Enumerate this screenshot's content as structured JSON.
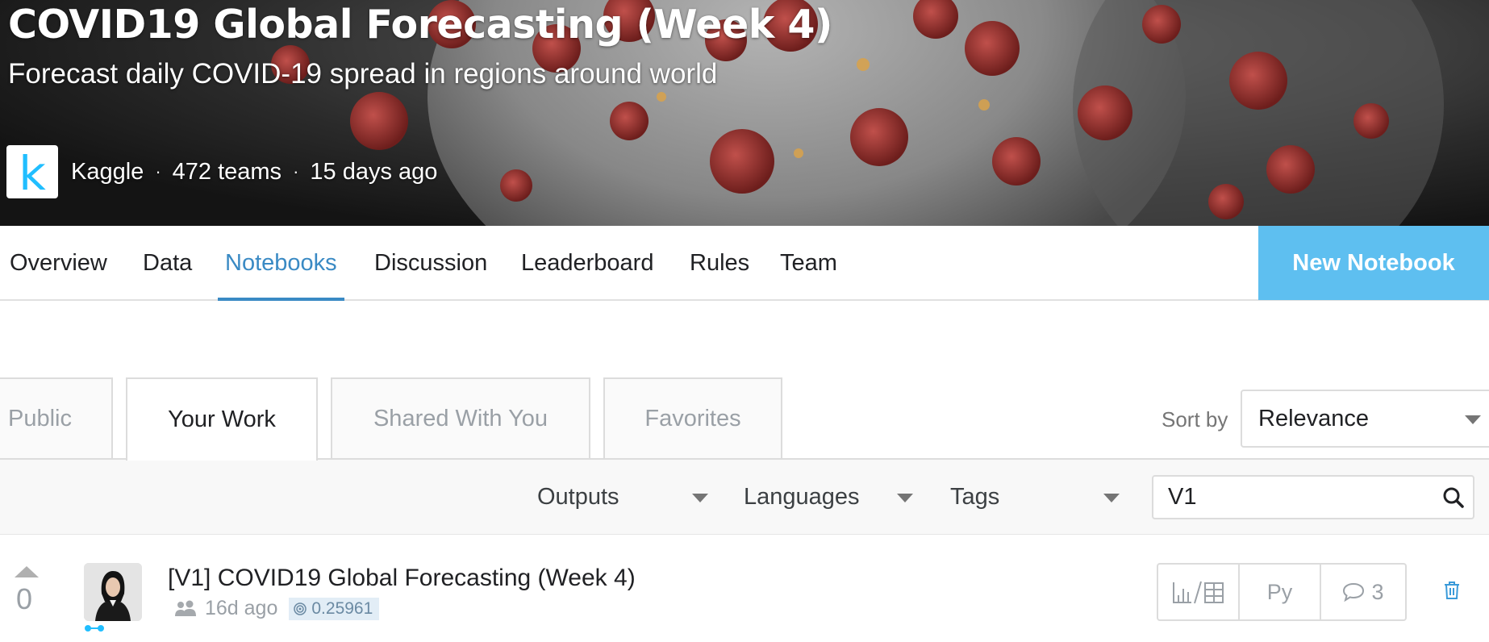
{
  "banner": {
    "title": "COVID19 Global Forecasting (Week 4)",
    "subtitle": "Forecast daily COVID-19 spread in regions around world",
    "host_logo_letter": "k",
    "host": "Kaggle",
    "teams": "472 teams",
    "ago": "15 days ago",
    "separator": "·"
  },
  "nav": {
    "tabs": [
      {
        "label": "Overview"
      },
      {
        "label": "Data"
      },
      {
        "label": "Notebooks",
        "active": true
      },
      {
        "label": "Discussion"
      },
      {
        "label": "Leaderboard"
      },
      {
        "label": "Rules"
      },
      {
        "label": "Team"
      }
    ],
    "new_notebook": "New Notebook"
  },
  "subtabs": [
    {
      "label": "Public"
    },
    {
      "label": "Your Work",
      "active": true
    },
    {
      "label": "Shared With You"
    },
    {
      "label": "Favorites"
    }
  ],
  "sort": {
    "label": "Sort by",
    "value": "Relevance"
  },
  "filters": {
    "outputs": "Outputs",
    "languages": "Languages",
    "tags": "Tags",
    "search_value": "V1"
  },
  "notebook": {
    "votes": "0",
    "title": "[V1] COVID19 Global Forecasting (Week 4)",
    "ago": "16d ago",
    "score": "0.25961",
    "language": "Py",
    "comments": "3"
  },
  "colors": {
    "accent": "#3a8ac4",
    "new_notebook_bg": "#5ebff0",
    "kaggle_blue": "#20beff",
    "delete_icon": "#3a9ad9"
  },
  "icons": {
    "search": "search-icon",
    "team": "team-icon",
    "score": "target-icon",
    "outputs": "chart-table-icon",
    "comment": "comment-icon",
    "delete": "trash-icon"
  }
}
